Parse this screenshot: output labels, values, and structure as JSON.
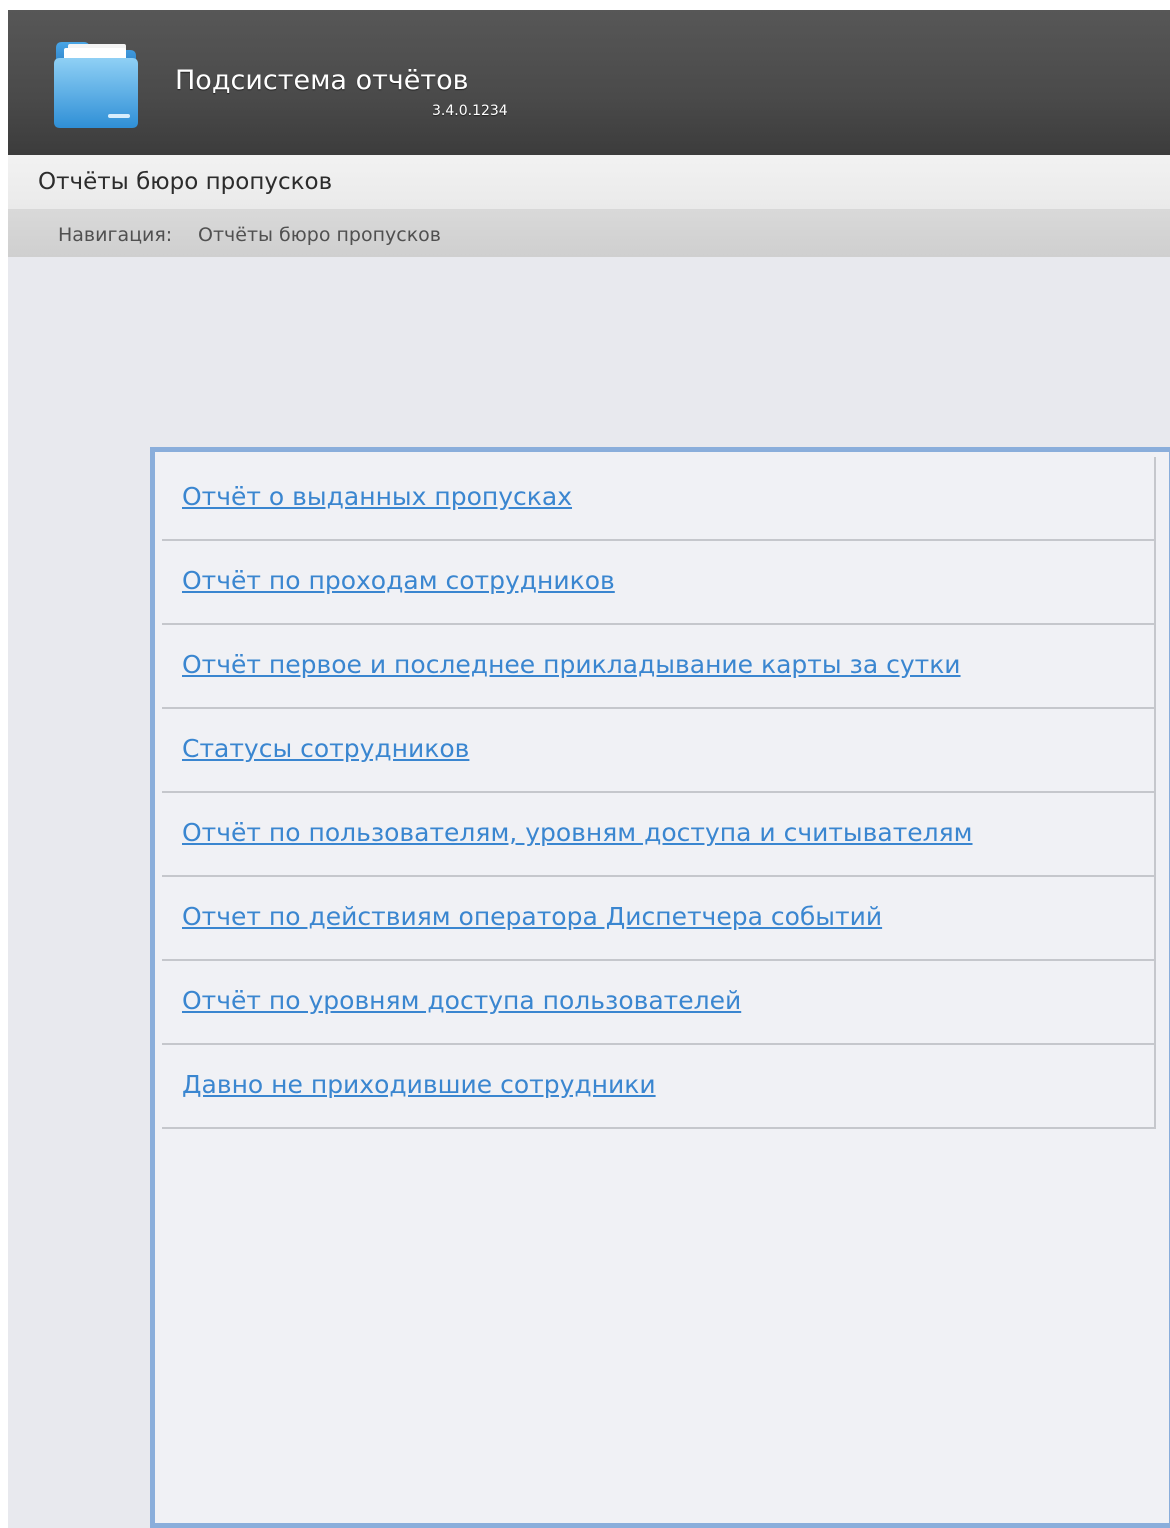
{
  "header": {
    "app_title": "Подсистема отчётов",
    "version": "3.4.0.1234",
    "logo_icon": "folder-icon"
  },
  "page": {
    "title": "Отчёты бюро пропусков"
  },
  "breadcrumb": {
    "label": "Навигация:",
    "current": "Отчёты бюро пропусков"
  },
  "reports": [
    {
      "label": "Отчёт о выданных пропусках"
    },
    {
      "label": "Отчёт по проходам сотрудников"
    },
    {
      "label": "Отчёт первое и последнее прикладывание карты за сутки"
    },
    {
      "label": "Статусы сотрудников"
    },
    {
      "label": "Отчёт по пользователям, уровням доступа и считывателям"
    },
    {
      "label": "Отчет по действиям оператора Диспетчера событий"
    },
    {
      "label": "Отчёт по уровням доступа пользователей"
    },
    {
      "label": "Давно не приходившие сотрудники"
    }
  ],
  "colors": {
    "link": "#3a86d0",
    "panel_border": "#8aaedb",
    "header_bg": "#4a4a4a"
  }
}
